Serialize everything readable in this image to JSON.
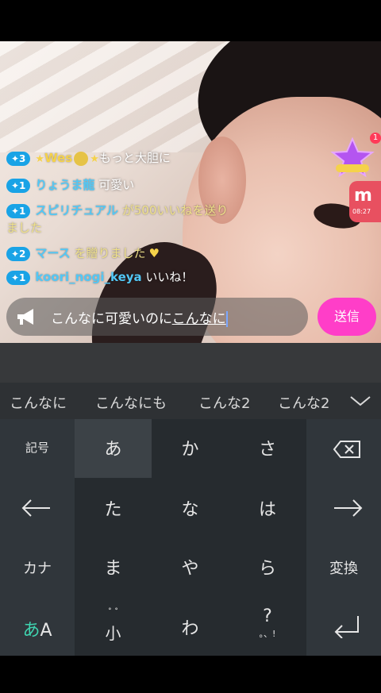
{
  "chat": {
    "messages": [
      {
        "badge": "✦3",
        "user": "Wes",
        "text": "もっと大胆に"
      },
      {
        "badge": "✦1",
        "user": "りょうま龍",
        "text": "可愛い"
      },
      {
        "badge": "✦1",
        "user": "スピリチュアル",
        "text": "が500いいねを送り",
        "text_cont": "ました"
      },
      {
        "badge": "✦2",
        "user": "マース",
        "text": "を贈りました"
      },
      {
        "badge": "✦1",
        "user": "koori_nogi_keya",
        "text": "いいね！"
      }
    ]
  },
  "overlay": {
    "notification_count": "1",
    "side_thumb_time": "08:27"
  },
  "input": {
    "text_plain": "こんなに可愛いのに",
    "text_composing": "こんなに"
  },
  "send": {
    "label": "送信"
  },
  "suggestions": [
    "こんなに",
    "こんなにも",
    "こんな2",
    "こんな2"
  ],
  "keyboard": {
    "symbols": "記号",
    "a": "あ",
    "ka": "か",
    "sa": "さ",
    "ta": "た",
    "na": "な",
    "ha": "は",
    "kana": "カナ",
    "ma": "ま",
    "ya": "や",
    "ra": "ら",
    "henkan": "変換",
    "mode": "あA",
    "small": "小",
    "wa": "わ",
    "punct": "?",
    "punct_sub": "。、!"
  },
  "colors": {
    "send": "#ff3ec8",
    "username": "#52c7f5",
    "badge": "#19a3e6",
    "keyboard_bg": "#262b2f"
  }
}
